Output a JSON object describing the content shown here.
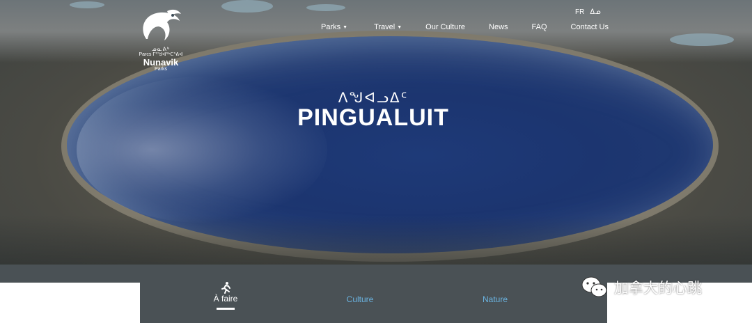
{
  "header": {
    "logo": {
      "syllabics": "ᓄᓇᕕᒃ",
      "parcs_line": "Parcs ᒥᕐᖑᐊᖅᑕᕐᕕᐊ",
      "name": "Nunavik",
      "parks": "Parks"
    },
    "languages": [
      "FR",
      "ᐃᓄ"
    ],
    "nav": [
      {
        "label": "Parks",
        "has_dropdown": true
      },
      {
        "label": "Travel",
        "has_dropdown": true
      },
      {
        "label": "Our Culture",
        "has_dropdown": false
      },
      {
        "label": "News",
        "has_dropdown": false
      },
      {
        "label": "FAQ",
        "has_dropdown": false
      },
      {
        "label": "Contact Us",
        "has_dropdown": false
      }
    ]
  },
  "hero": {
    "subtitle": "ᐱᖑᐊᓗᐃᑦ",
    "title": "PINGUALUIT"
  },
  "tabs": [
    {
      "label": "À faire",
      "active": true,
      "icon": "running-person-icon"
    },
    {
      "label": "Culture",
      "active": false
    },
    {
      "label": "Nature",
      "active": false
    }
  ],
  "watermark": {
    "text": "加拿大的心跳",
    "icon": "wechat-icon"
  },
  "colors": {
    "tab_bar": "#4a5155",
    "inactive_tab": "#6ab3e0",
    "lake": "#1e3a78"
  }
}
